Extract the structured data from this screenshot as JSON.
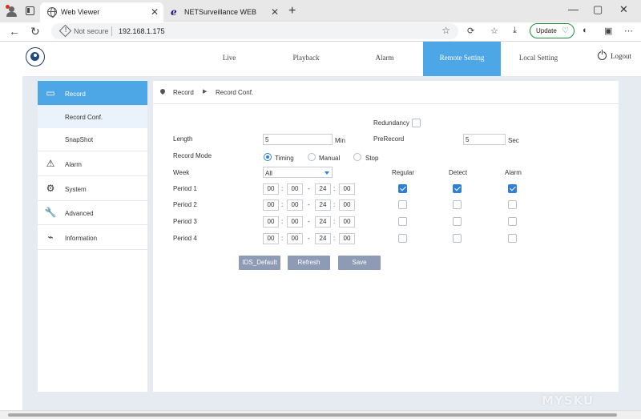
{
  "browser": {
    "tabs": [
      {
        "title": "Web Viewer",
        "icon": "globe-icon",
        "active": true
      },
      {
        "title": "NETSurveillance WEB",
        "icon": "ie-icon",
        "active": false
      }
    ],
    "close_glyph": "✕",
    "new_tab_glyph": "+",
    "window_controls": [
      "—",
      "▢",
      "✕"
    ],
    "address": {
      "security": "Not secure",
      "url": "192.168.1.175"
    },
    "update_label": "Update",
    "nav_glyphs": {
      "back": "←",
      "refresh": "↻",
      "star": "☆",
      "more": "⋯"
    }
  },
  "app": {
    "nav": [
      "Live",
      "Playback",
      "Alarm",
      "Remote Setting",
      "Local Setting"
    ],
    "active_nav": "Remote Setting",
    "logout": "Logout",
    "accent_color": "#4da6e6"
  },
  "sidebar": {
    "record": {
      "label": "Record",
      "icon": "record-icon"
    },
    "sub_items": [
      "Record Conf.",
      "SnapShot"
    ],
    "items": [
      {
        "label": "Alarm",
        "icon": "alarm-icon",
        "glyph": "⚠"
      },
      {
        "label": "System",
        "icon": "gear-icon",
        "glyph": "⚙"
      },
      {
        "label": "Advanced",
        "icon": "wrench-icon",
        "glyph": "🔧"
      },
      {
        "label": "Information",
        "icon": "info-icon",
        "glyph": "⌁"
      }
    ]
  },
  "breadcrumb": {
    "items": [
      "Record",
      "Record Conf."
    ],
    "sep": "▶"
  },
  "form": {
    "redundancy_label": "Redundancy",
    "redundancy_checked": false,
    "length_label": "Length",
    "length_value": "5",
    "length_unit": "Min",
    "prerecord_label": "PreRecord",
    "prerecord_value": "5",
    "prerecord_unit": "Sec",
    "record_mode_label": "Record Mode",
    "modes": [
      "Timing",
      "Manual",
      "Stop"
    ],
    "selected_mode": "Timing",
    "week_label": "Week",
    "week_value": "All",
    "columns": [
      "Regular",
      "Detect",
      "Alarm"
    ],
    "time_sep": ":",
    "range_sep": "-",
    "periods": [
      {
        "label": "Period 1",
        "start": [
          "00",
          "00"
        ],
        "end": [
          "24",
          "00"
        ],
        "regular": true,
        "detect": true,
        "alarm": true
      },
      {
        "label": "Period 2",
        "start": [
          "00",
          "00"
        ],
        "end": [
          "24",
          "00"
        ],
        "regular": false,
        "detect": false,
        "alarm": false
      },
      {
        "label": "Period 3",
        "start": [
          "00",
          "00"
        ],
        "end": [
          "24",
          "00"
        ],
        "regular": false,
        "detect": false,
        "alarm": false
      },
      {
        "label": "Period 4",
        "start": [
          "00",
          "00"
        ],
        "end": [
          "24",
          "00"
        ],
        "regular": false,
        "detect": false,
        "alarm": false
      }
    ]
  },
  "buttons": {
    "default": "IDS_Default",
    "refresh": "Refresh",
    "save": "Save"
  },
  "watermark": "MYSKU"
}
